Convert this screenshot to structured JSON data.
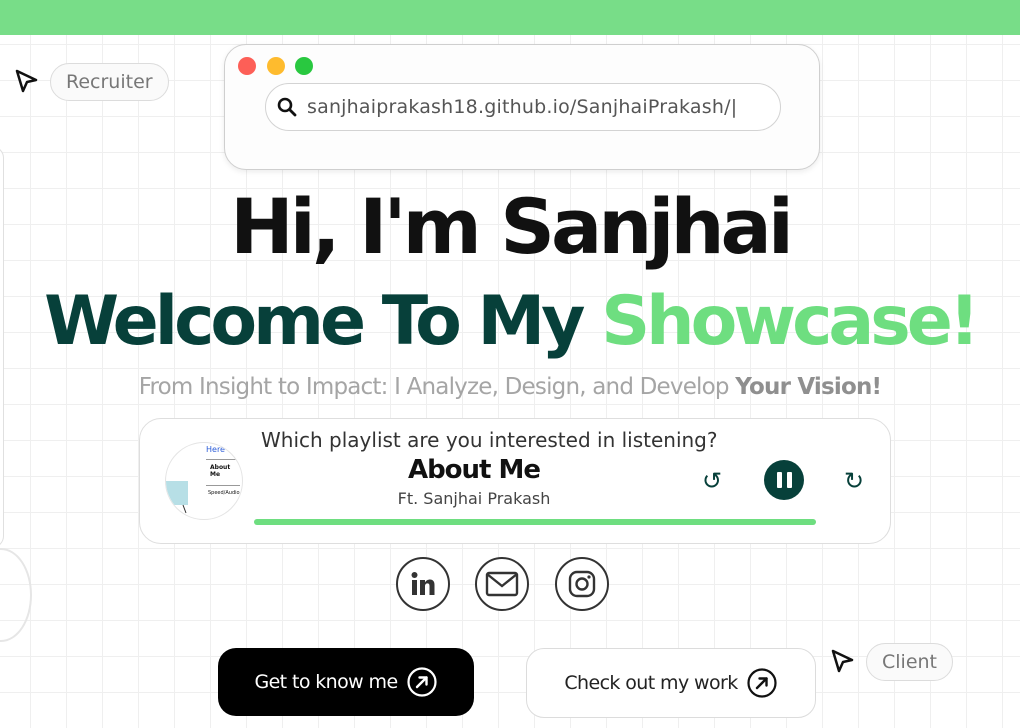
{
  "browser": {
    "url": "sanjhaiprakash18.github.io/SanjhaiPrakash/|"
  },
  "tags": {
    "recruiter": "Recruiter",
    "client": "Client"
  },
  "hero": {
    "greeting": "Hi, I'm Sanjhai",
    "welcome": "Welcome To My",
    "welcome_accent": "Showcase!",
    "tagline": "From Insight to Impact: I Analyze, Design, and Develop",
    "tagline_bold": "Your Vision!"
  },
  "player": {
    "question": "Which playlist are you interested in listening?",
    "title": "About Me",
    "artist": "Ft. Sanjhai Prakash",
    "progress": 1.0,
    "thumb_lines": [
      "Here",
      "About Me",
      "Speed/Audio"
    ]
  },
  "social": {
    "icons": [
      "linkedin-icon",
      "mail-icon",
      "instagram-icon"
    ]
  },
  "buttons": {
    "primary": "Get to know me",
    "secondary": "Check out my work"
  },
  "colors": {
    "accent_green": "#6ede80",
    "top_bar": "#78dd88",
    "dark_teal": "#07403a"
  }
}
